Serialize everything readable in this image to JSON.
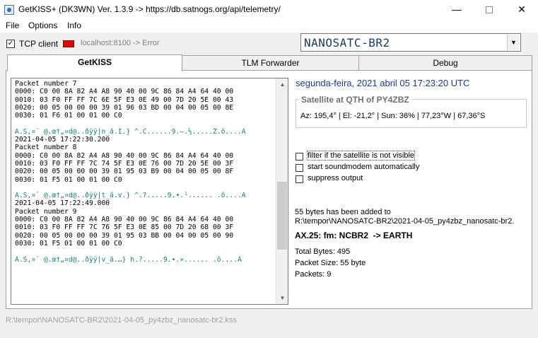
{
  "window": {
    "title": "GetKISS+ (DK3WN) Ver. 1.3.9 -> https://db.satnogs.org/api/telemetry/",
    "minimize": "—",
    "close": "✕"
  },
  "menu": {
    "file": "File",
    "options": "Options",
    "info": "Info"
  },
  "toolbar": {
    "tcp_checked": "✓",
    "tcp_label": "TCP client",
    "status_color": "#e00000",
    "status_text": "localhost:8100 -> Error"
  },
  "satellite_select": {
    "value": "NANOSATC-BR2",
    "arrow": "▼"
  },
  "tabs": [
    {
      "label": "GetKISS"
    },
    {
      "label": "TLM Forwarder"
    },
    {
      "label": "Debug"
    }
  ],
  "log": {
    "lines": [
      "Packet number 7",
      "0000: C0 00 8A 82 A4 A8 90 40 00 9C 86 84 A4 64 40 00",
      "0010: 03 F0 FF FF 7C 6E 5F E3 0E 49 00 7D 20 5E 00 43",
      "0020: 00 05 00 00 00 39 01 96 03 BD 00 04 00 05 00 8E",
      "0030: 01 F6 01 00 01 00 C0",
      "",
      "À.Š,¤¨ @.œ†„¤d@..ðÿÿ|n_ã.I.} ^.C......9.–.½.....Ž.ö....À",
      "2021-04-05 17:22:30.200",
      "Packet number 8",
      "0000: C0 00 8A 82 A4 A8 90 40 00 9C 86 84 A4 64 40 00",
      "0010: 03 F0 FF FF 7C 74 5F E3 0E 76 00 7D 20 5E 00 3F",
      "0020: 00 05 00 00 00 39 01 95 03 B9 00 04 00 05 00 8F",
      "0030: 01 F5 01 00 01 00 C0",
      "",
      "À.Š,¤¨ @.œ†„¤d@..ðÿÿ|t_ã.v.} ^.?.....9.•.¹...... .õ....À",
      "2021-04-05 17:22:49.000",
      "Packet number 9",
      "0000: C0 00 8A 82 A4 A8 90 40 00 9C 86 84 A4 64 40 00",
      "0010: 03 F0 FF FF 7C 76 5F E3 0E 85 00 7D 20 68 00 3F",
      "0020: 00 05 00 00 00 39 01 95 03 BB 00 04 00 05 00 90",
      "0030: 01 F5 01 00 01 00 C0",
      "",
      "À.Š,¤¨ @.œ†„¤d@..ðÿÿ|v_ã.…} h.?.....9.•.»...... .õ....À"
    ],
    "scroll_up": "▲",
    "scroll_down": "▼",
    "scroll_position": 0.68
  },
  "datetime": "segunda-feira, 2021 abril 05  17:23:20 UTC",
  "qth": {
    "title": "Satellite at QTH of PY4ZBZ",
    "info": "Az: 195,4° | El: -21,2° | Sun: 36% | 77,23°W | 67,36°S"
  },
  "options": [
    {
      "label": "filter if the satellite is not visible",
      "checked": false
    },
    {
      "label": "start soundmodem automatically",
      "checked": false
    },
    {
      "label": "suppress output",
      "checked": false
    }
  ],
  "status": {
    "added_line1": "55 bytes has been added to",
    "added_line2": "R:\\tempor\\NANOSATC-BR2\\2021-04-05_py4zbz_nanosatc-br2.",
    "ax25": "AX.25: fm: NCBR2  -> EARTH",
    "total_bytes": "Total Bytes: 495",
    "packet_size": "Packet Size: 55 byte",
    "packets": "Packets: 9"
  },
  "footer_path": "R:\\tempor\\NANOSATC-BR2\\2021-04-05_py4zbz_nanosatc-br2.kss"
}
